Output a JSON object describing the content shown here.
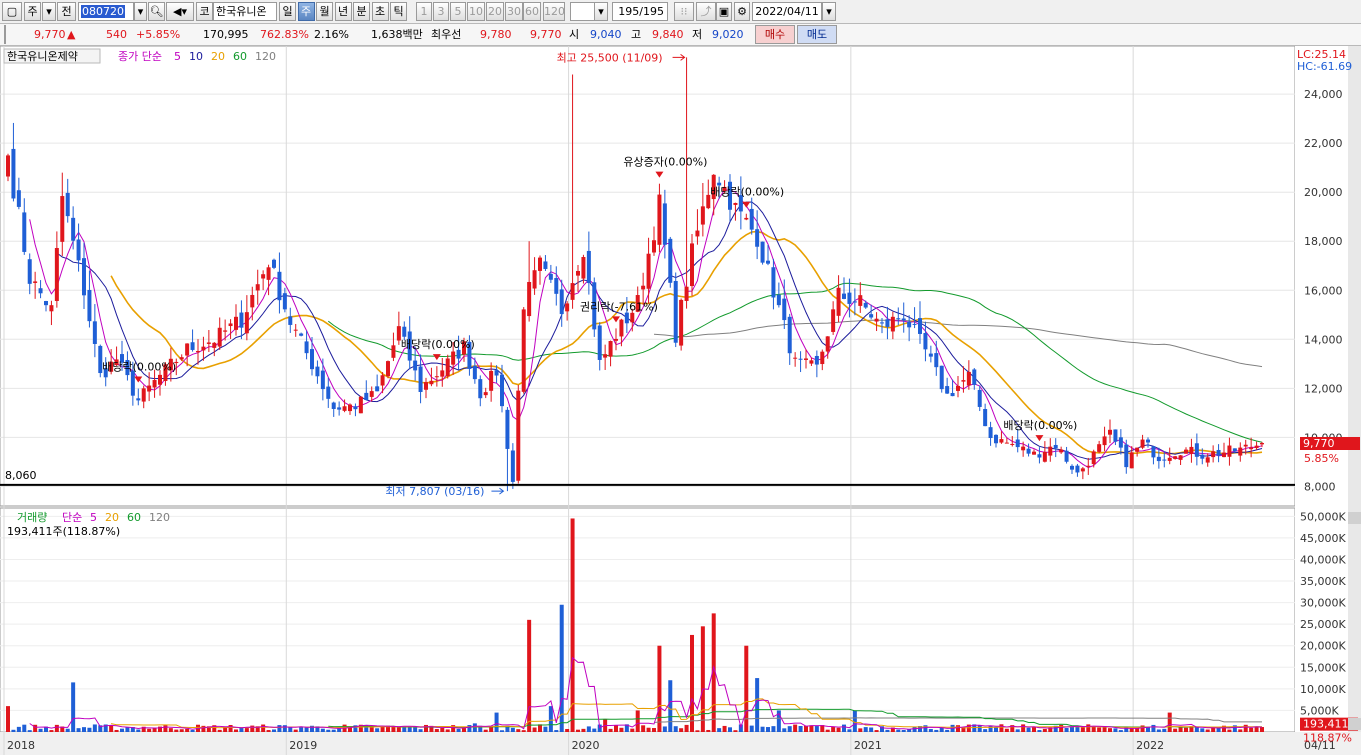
{
  "toolbar": {
    "period": "주",
    "prev": "전",
    "code": "080720",
    "kind_marker": "코",
    "stock_name": "한국유니온",
    "intervals": [
      {
        "label": "일",
        "active": false
      },
      {
        "label": "주",
        "active": true
      },
      {
        "label": "월",
        "active": false
      },
      {
        "label": "년",
        "active": false
      },
      {
        "label": "분",
        "active": false
      },
      {
        "label": "초",
        "active": false
      },
      {
        "label": "틱",
        "active": false
      }
    ],
    "multipliers": [
      "1",
      "3",
      "5",
      "10",
      "20",
      "30",
      "60",
      "120"
    ],
    "count": "195/195",
    "date": "2022/04/11"
  },
  "quote": {
    "price": "9,770",
    "change": "540",
    "change_pct": "+5.85%",
    "volume": "170,995",
    "volume_pct": "762.83%",
    "turnover_pct": "2.16%",
    "amount": "1,638백만",
    "bid_ask_label": "최우선",
    "best_ask": "9,780",
    "best_bid": "9,770",
    "open_label": "시",
    "open": "9,040",
    "high_label": "고",
    "high": "9,840",
    "low_label": "저",
    "low": "9,020",
    "buy_label": "매수",
    "sell_label": "매도"
  },
  "colors": {
    "up": "#e0161c",
    "down": "#1f5fd6",
    "ma5": "#c000c0",
    "ma10": "#1c1c9c",
    "ma20": "#e8a000",
    "ma60": "#129a2c",
    "ma120": "#808080"
  },
  "chart_data": [
    {
      "type": "candlestick",
      "title": "한국유니온제약",
      "legend_title": "종가 단순",
      "ma_periods": [
        "5",
        "10",
        "20",
        "60",
        "120"
      ],
      "corner_labels": [
        "LC:25.14",
        "HC:-61.69"
      ],
      "ylim": [
        7200,
        25800
      ],
      "y_ticks": [
        {
          "value": 8000,
          "label": "8,000"
        },
        {
          "value": 10000,
          "label": "10,000"
        },
        {
          "value": 12000,
          "label": "12,000"
        },
        {
          "value": 14000,
          "label": "14,000"
        },
        {
          "value": 16000,
          "label": "16,000"
        },
        {
          "value": 18000,
          "label": "18,000"
        },
        {
          "value": 20000,
          "label": "20,000"
        },
        {
          "value": 22000,
          "label": "22,000"
        },
        {
          "value": 24000,
          "label": "24,000"
        }
      ],
      "x_labels": [
        {
          "index": 0,
          "label": "2018"
        },
        {
          "index": 52,
          "label": "2019"
        },
        {
          "index": 104,
          "label": "2020"
        },
        {
          "index": 156,
          "label": "2021"
        },
        {
          "index": 208,
          "label": "2022"
        },
        {
          "index": 231,
          "label": "04/11"
        }
      ],
      "base_line": {
        "value": 8060,
        "label": "8,060"
      },
      "current": {
        "price_label": "9,770",
        "change_label": "5.85%"
      },
      "annotations": [
        {
          "index": 24,
          "text": "배당락(0.00%)"
        },
        {
          "index": 79,
          "text": "배당락(0.00%)"
        },
        {
          "index": 112,
          "text": "권리락(-7.61%)"
        },
        {
          "index": 120,
          "text": "유상증자(0.00%)"
        },
        {
          "index": 136,
          "text": "배당락(0.00%)"
        },
        {
          "index": 190,
          "text": "배당락(0.00%)"
        }
      ],
      "high_mark": {
        "index": 125,
        "value": 25500,
        "text": "최고 25,500 (11/09)"
      },
      "low_mark": {
        "index": 92,
        "value": 7807,
        "text": "최저 7,807 (03/16)"
      },
      "anchors": [
        {
          "i": 0,
          "c": 21500
        },
        {
          "i": 4,
          "c": 16500
        },
        {
          "i": 8,
          "c": 15200
        },
        {
          "i": 10,
          "c": 19800
        },
        {
          "i": 14,
          "c": 16000
        },
        {
          "i": 17,
          "c": 12500
        },
        {
          "i": 20,
          "c": 13200
        },
        {
          "i": 24,
          "c": 11500
        },
        {
          "i": 28,
          "c": 12500
        },
        {
          "i": 33,
          "c": 13600
        },
        {
          "i": 38,
          "c": 14000
        },
        {
          "i": 43,
          "c": 14800
        },
        {
          "i": 48,
          "c": 17200
        },
        {
          "i": 52,
          "c": 14700
        },
        {
          "i": 56,
          "c": 13000
        },
        {
          "i": 60,
          "c": 11200
        },
        {
          "i": 64,
          "c": 11300
        },
        {
          "i": 68,
          "c": 11800
        },
        {
          "i": 72,
          "c": 14400
        },
        {
          "i": 76,
          "c": 12000
        },
        {
          "i": 80,
          "c": 12800
        },
        {
          "i": 84,
          "c": 13700
        },
        {
          "i": 87,
          "c": 11800
        },
        {
          "i": 90,
          "c": 12700
        },
        {
          "i": 93,
          "c": 8200
        },
        {
          "i": 95,
          "c": 15500
        },
        {
          "i": 98,
          "c": 17000
        },
        {
          "i": 102,
          "c": 15200
        },
        {
          "i": 106,
          "c": 17800
        },
        {
          "i": 109,
          "c": 13000
        },
        {
          "i": 112,
          "c": 14200
        },
        {
          "i": 116,
          "c": 15500
        },
        {
          "i": 120,
          "c": 19500
        },
        {
          "i": 123,
          "c": 14200
        },
        {
          "i": 126,
          "c": 17500
        },
        {
          "i": 130,
          "c": 21000
        },
        {
          "i": 134,
          "c": 19300
        },
        {
          "i": 138,
          "c": 18200
        },
        {
          "i": 141,
          "c": 16000
        },
        {
          "i": 145,
          "c": 13000
        },
        {
          "i": 149,
          "c": 12800
        },
        {
          "i": 153,
          "c": 15800
        },
        {
          "i": 157,
          "c": 15500
        },
        {
          "i": 161,
          "c": 14500
        },
        {
          "i": 165,
          "c": 15000
        },
        {
          "i": 169,
          "c": 13500
        },
        {
          "i": 173,
          "c": 11700
        },
        {
          "i": 177,
          "c": 12500
        },
        {
          "i": 181,
          "c": 10000
        },
        {
          "i": 185,
          "c": 9700
        },
        {
          "i": 189,
          "c": 9300
        },
        {
          "i": 193,
          "c": 9700
        },
        {
          "i": 197,
          "c": 8500
        },
        {
          "i": 200,
          "c": 9300
        },
        {
          "i": 203,
          "c": 10100
        },
        {
          "i": 206,
          "c": 9000
        },
        {
          "i": 209,
          "c": 9800
        },
        {
          "i": 212,
          "c": 9200
        },
        {
          "i": 216,
          "c": 9500
        },
        {
          "i": 220,
          "c": 9300
        },
        {
          "i": 224,
          "c": 9400
        },
        {
          "i": 227,
          "c": 9500
        },
        {
          "i": 231,
          "c": 9770
        }
      ]
    },
    {
      "type": "bar",
      "title": "거래량",
      "legend_title": "단순",
      "ma_periods": [
        "5",
        "20",
        "60",
        "120"
      ],
      "info": "193,411주(118.87%)",
      "ylim": [
        0,
        51000
      ],
      "y_ticks": [
        {
          "value": 5000,
          "label": "5,000K"
        },
        {
          "value": 10000,
          "label": "10,000K"
        },
        {
          "value": 15000,
          "label": "15,000K"
        },
        {
          "value": 20000,
          "label": "20,000K"
        },
        {
          "value": 25000,
          "label": "25,000K"
        },
        {
          "value": 30000,
          "label": "30,000K"
        },
        {
          "value": 35000,
          "label": "35,000K"
        },
        {
          "value": 40000,
          "label": "40,000K"
        },
        {
          "value": 45000,
          "label": "45,000K"
        },
        {
          "value": 50000,
          "label": "50,000K"
        }
      ],
      "current": {
        "volume_label": "193,411",
        "pct_label": "118.87%"
      },
      "spikes": [
        {
          "i": 0,
          "v": 6000
        },
        {
          "i": 12,
          "v": 11500
        },
        {
          "i": 86,
          "v": 2000
        },
        {
          "i": 90,
          "v": 4500
        },
        {
          "i": 96,
          "v": 26000
        },
        {
          "i": 100,
          "v": 6000
        },
        {
          "i": 102,
          "v": 29500
        },
        {
          "i": 104,
          "v": 49500
        },
        {
          "i": 110,
          "v": 3000
        },
        {
          "i": 116,
          "v": 5000
        },
        {
          "i": 120,
          "v": 20000
        },
        {
          "i": 122,
          "v": 12000
        },
        {
          "i": 126,
          "v": 22500
        },
        {
          "i": 128,
          "v": 24500
        },
        {
          "i": 130,
          "v": 27500
        },
        {
          "i": 136,
          "v": 20000
        },
        {
          "i": 138,
          "v": 12500
        },
        {
          "i": 142,
          "v": 5000
        },
        {
          "i": 156,
          "v": 5000
        },
        {
          "i": 214,
          "v": 4500
        }
      ]
    }
  ]
}
